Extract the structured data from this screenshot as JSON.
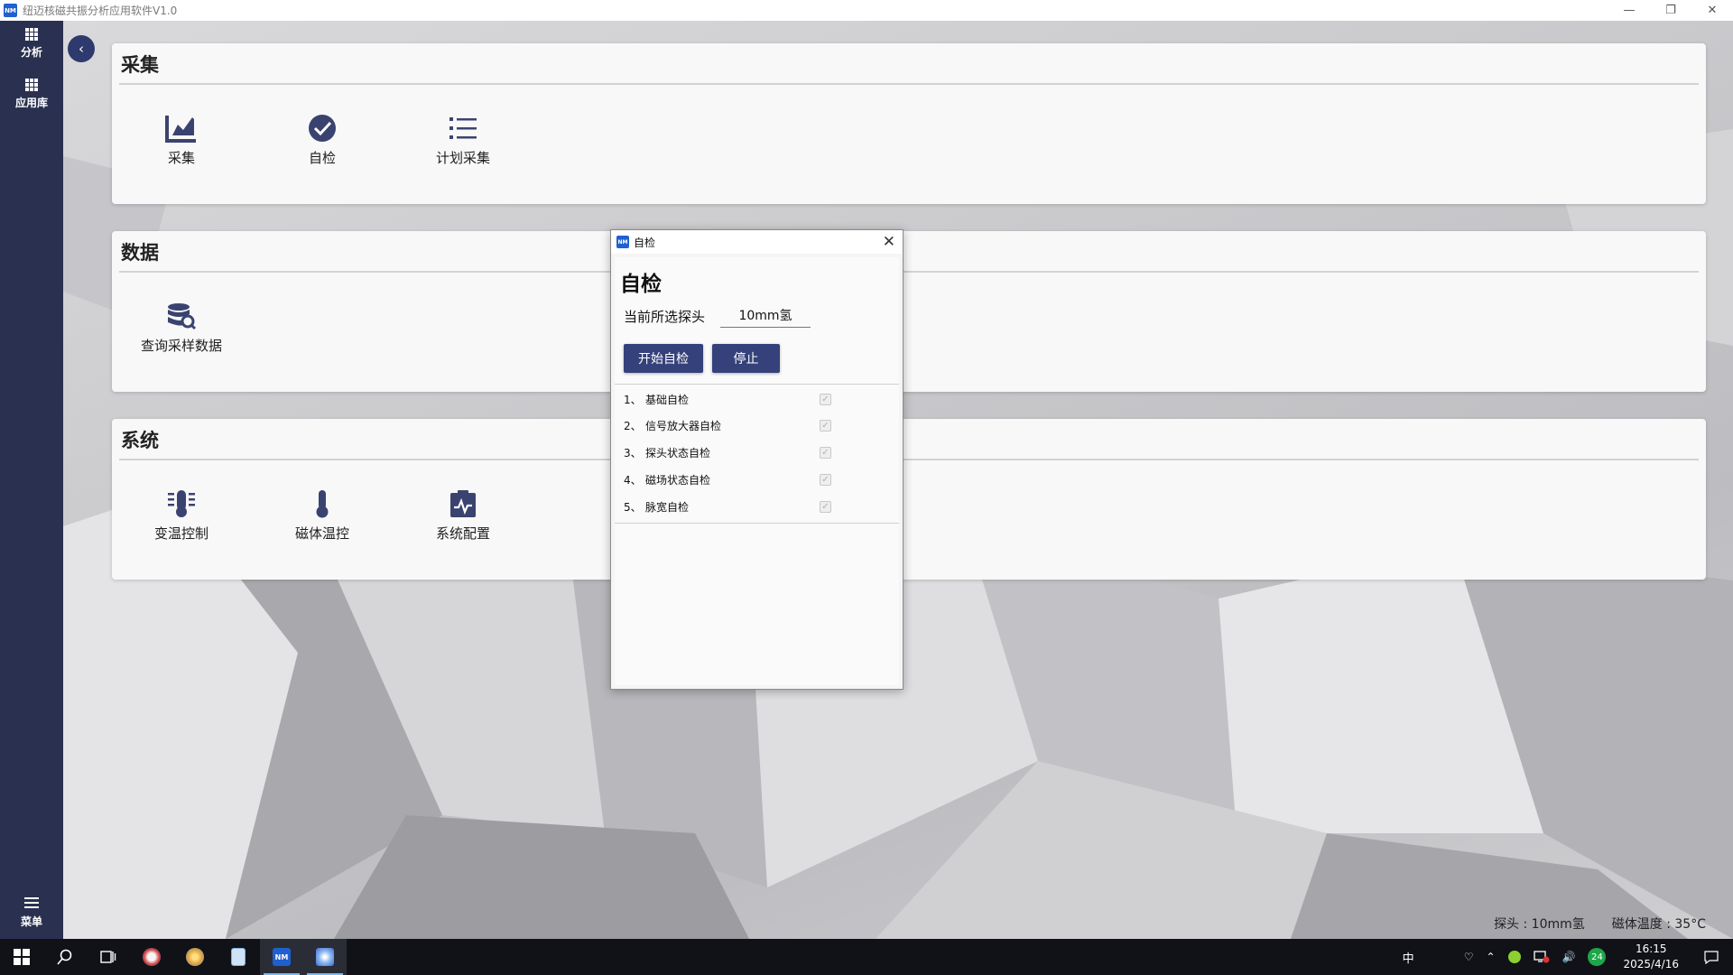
{
  "window": {
    "title": "纽迈核磁共振分析应用软件V1.0",
    "logo_text": "NM"
  },
  "sidebar": {
    "items": [
      {
        "label": "分析",
        "icon": "grid-icon"
      },
      {
        "label": "应用库",
        "icon": "grid-icon"
      }
    ],
    "menu_label": "菜单",
    "collapse_glyph": "‹"
  },
  "sections": [
    {
      "title": "采集",
      "tiles": [
        {
          "label": "采集",
          "icon": "chart-icon"
        },
        {
          "label": "自检",
          "icon": "check-circle-icon"
        },
        {
          "label": "计划采集",
          "icon": "list-icon"
        }
      ]
    },
    {
      "title": "数据",
      "tiles": [
        {
          "label": "查询采样数据",
          "icon": "database-search-icon"
        }
      ]
    },
    {
      "title": "系统",
      "tiles": [
        {
          "label": "变温控制",
          "icon": "thermostat-icon"
        },
        {
          "label": "磁体温控",
          "icon": "thermometer-icon"
        },
        {
          "label": "系统配置",
          "icon": "clipboard-pulse-icon"
        }
      ]
    }
  ],
  "dialog": {
    "title": "自检",
    "heading": "自检",
    "probe_label": "当前所选探头",
    "probe_value": "10mm氢",
    "start_button": "开始自检",
    "stop_button": "停止",
    "checks": [
      {
        "num": "1、",
        "label": "基础自检",
        "checked": true
      },
      {
        "num": "2、",
        "label": "信号放大器自检",
        "checked": true
      },
      {
        "num": "3、",
        "label": "探头状态自检",
        "checked": true
      },
      {
        "num": "4、",
        "label": "磁场状态自检",
        "checked": true
      },
      {
        "num": "5、",
        "label": "脉宽自检",
        "checked": true
      }
    ]
  },
  "status": {
    "probe": "探头 : 10mm氢",
    "magnet_temp": "磁体温度 : 35°C"
  },
  "taskbar": {
    "time": "16:15",
    "date": "2025/4/16",
    "ime": "中",
    "notification_count": "24"
  },
  "colors": {
    "sidebar": "#2a3150",
    "accent": "#35417a",
    "icon": "#3a4370"
  }
}
